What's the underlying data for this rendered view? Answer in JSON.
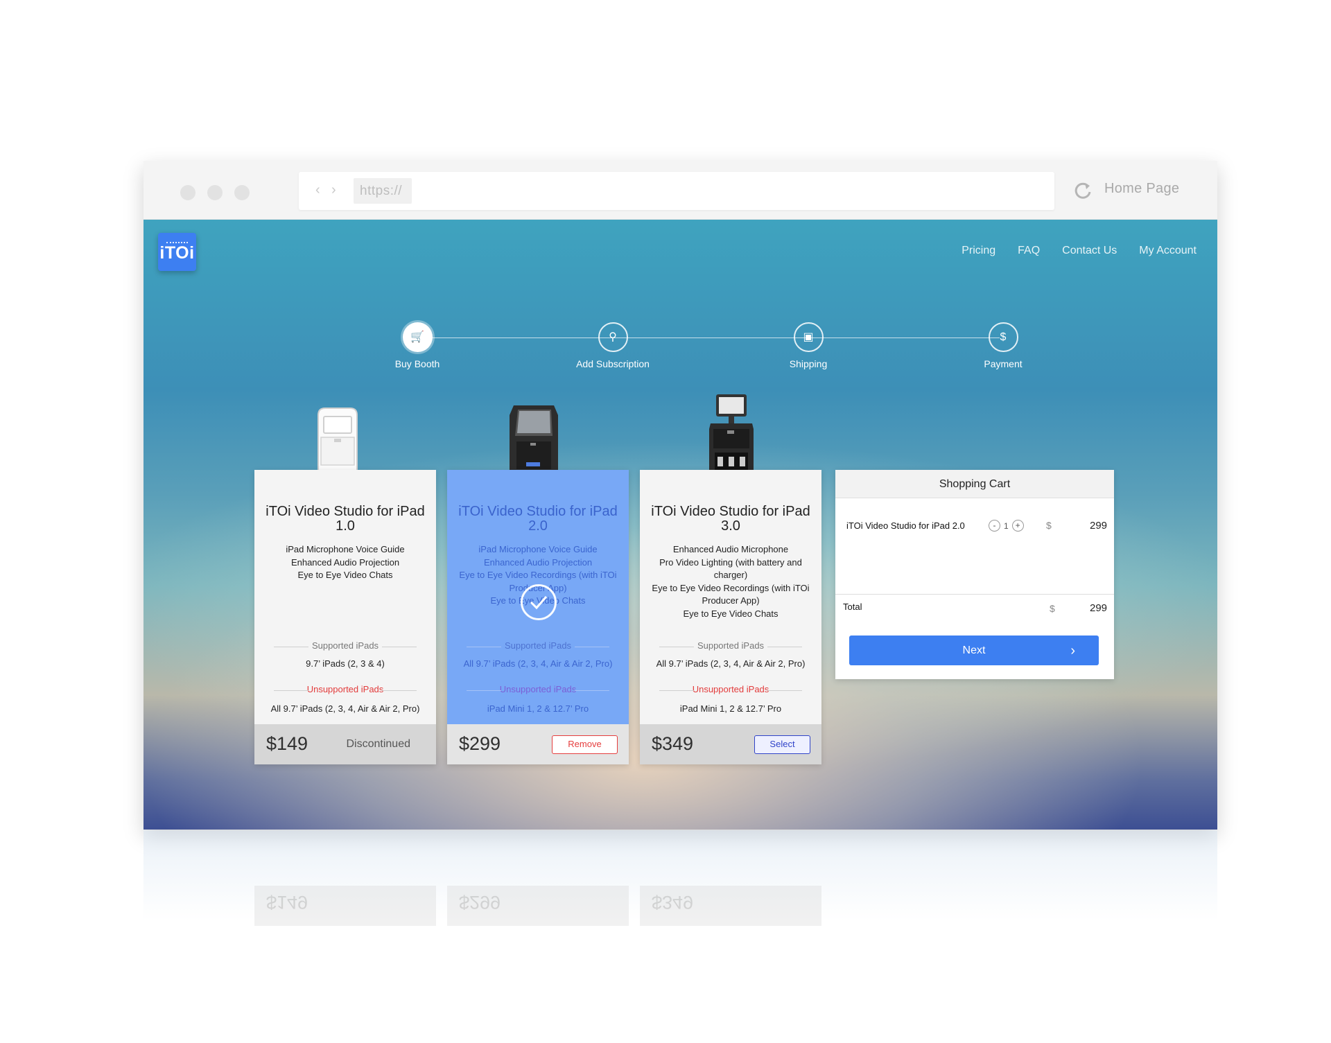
{
  "browser": {
    "url": "https://",
    "home_label": "Home Page",
    "icons": [
      "back-icon",
      "forward-icon",
      "refresh-icon"
    ]
  },
  "brand": {
    "logo_text": "iTOi",
    "accent": "#3d7ff1"
  },
  "nav": {
    "items": [
      "Pricing",
      "FAQ",
      "Contact Us",
      "My Account"
    ]
  },
  "steps": [
    {
      "label": "Buy Booth",
      "icon": "cart-icon",
      "glyph": "🛒",
      "active": true
    },
    {
      "label": "Add Subscription",
      "icon": "wrench-icon",
      "glyph": "⚲",
      "active": false
    },
    {
      "label": "Shipping",
      "icon": "box-icon",
      "glyph": "▣",
      "active": false
    },
    {
      "label": "Payment",
      "icon": "dollar-icon",
      "glyph": "$",
      "active": false
    }
  ],
  "products": [
    {
      "title": "iTOi Video Studio for iPad 1.0",
      "features": [
        "iPad Microphone Voice Guide",
        "Enhanced Audio Projection",
        "Eye to Eye Video Chats"
      ],
      "supported_label": "Supported iPads",
      "supported": "9.7’ iPads (2, 3 & 4)",
      "unsupported_label": "Unsupported iPads",
      "unsupported": "All 9.7’ iPads (2, 3, 4, Air & Air 2, Pro)",
      "price": "$149",
      "status": "Discontinued",
      "selected": false
    },
    {
      "title": "iTOi Video Studio for iPad 2.0",
      "features": [
        "iPad Microphone Voice Guide",
        "Enhanced Audio Projection",
        "Eye to Eye Video Recordings (with iTOi Producer App)",
        "Eye to Eye Video Chats"
      ],
      "supported_label": "Supported iPads",
      "supported": "All 9.7’ iPads (2, 3, 4, Air & Air 2, Pro)",
      "unsupported_label": "Unsupported iPads",
      "unsupported": "iPad Mini 1, 2 & 12.7’ Pro",
      "price": "$299",
      "button": "Remove",
      "selected": true
    },
    {
      "title": "iTOi Video Studio for iPad 3.0",
      "features": [
        "Enhanced Audio Microphone",
        "Pro Video Lighting (with battery and charger)",
        "Eye to Eye Video Recordings (with iTOi Producer App)",
        "Eye to Eye Video Chats"
      ],
      "supported_label": "Supported iPads",
      "supported": "All 9.7’ iPads (2, 3, 4, Air & Air 2, Pro)",
      "unsupported_label": "Unsupported iPads",
      "unsupported": "iPad Mini 1, 2 & 12.7’ Pro",
      "price": "$349",
      "button": "Select",
      "selected": false
    }
  ],
  "cart": {
    "title": "Shopping Cart",
    "item_name": "iTOi Video Studio for iPad 2.0",
    "minus": "-",
    "quantity": "1",
    "plus": "+",
    "currency": "$",
    "item_amount": "299",
    "total_label": "Total",
    "total_amount": "299",
    "next_label": "Next",
    "next_chevron": "›"
  },
  "reflection": [
    "$149",
    "$299",
    "$349"
  ]
}
